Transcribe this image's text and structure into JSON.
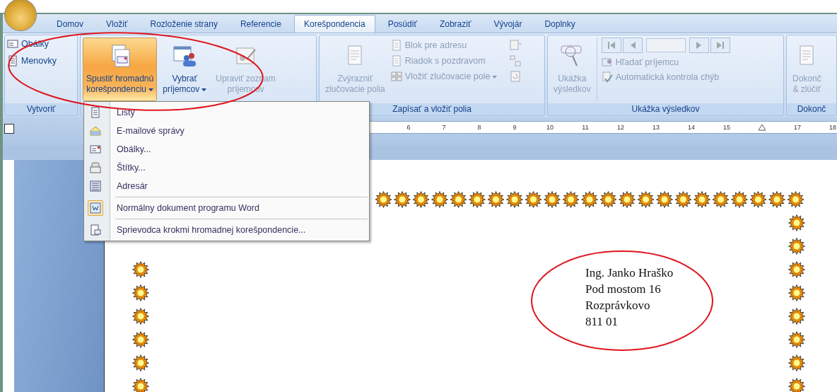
{
  "tabs": [
    {
      "label": "Domov",
      "selected": false
    },
    {
      "label": "Vložiť",
      "selected": false
    },
    {
      "label": "Rozloženie strany",
      "selected": false
    },
    {
      "label": "Referencie",
      "selected": false
    },
    {
      "label": "Korešpondencia",
      "selected": true
    },
    {
      "label": "Posúdiť",
      "selected": false
    },
    {
      "label": "Zobraziť",
      "selected": false
    },
    {
      "label": "Vývojár",
      "selected": false
    },
    {
      "label": "Doplnky",
      "selected": false
    }
  ],
  "ribbon": {
    "groups": [
      {
        "kind": "create",
        "label": "Vytvoriť",
        "small": [
          {
            "label": "Obálky",
            "disabled": false
          },
          {
            "label": "Menovky",
            "disabled": false
          }
        ]
      },
      {
        "kind": "start",
        "large": [
          {
            "lines": [
              "Spustiť hromadnú",
              "korešpondenciu"
            ],
            "dropdown": true,
            "pressed": true,
            "disabled": false
          },
          {
            "lines": [
              "Vybrať",
              "príjemcov"
            ],
            "dropdown": true,
            "pressed": false,
            "disabled": false
          },
          {
            "lines": [
              "Upraviť zoznam",
              "príjemcov"
            ],
            "dropdown": false,
            "pressed": false,
            "disabled": true
          }
        ]
      },
      {
        "kind": "write",
        "label": "Zapísať a vložiť polia",
        "large": [
          {
            "lines": [
              "Zvýrazniť",
              "zlučovacie polia"
            ],
            "dropdown": false,
            "pressed": false,
            "disabled": true
          }
        ],
        "small": [
          {
            "label": "Blok pre adresu",
            "disabled": true,
            "dropdown": false
          },
          {
            "label": "Riadok s pozdravom",
            "disabled": true,
            "dropdown": false
          },
          {
            "label": "Vložiť zlučovacie pole",
            "disabled": true,
            "dropdown": true
          }
        ]
      },
      {
        "kind": "preview",
        "label": "Ukážka výsledkov",
        "large": [
          {
            "lines": [
              "Ukážka",
              "výsledkov"
            ],
            "dropdown": false,
            "pressed": false,
            "disabled": true
          }
        ],
        "small": [
          {
            "label": "Hľadať príjemcu",
            "disabled": true
          },
          {
            "label": "Automatická kontrola chýb",
            "disabled": true
          }
        ]
      },
      {
        "kind": "finish",
        "label": "Dokonč",
        "large": [
          {
            "lines": [
              "Dokonč",
              "& zlúčiť"
            ],
            "dropdown": false,
            "pressed": false,
            "disabled": true
          }
        ]
      }
    ]
  },
  "menu": {
    "items": [
      {
        "label": "Listy",
        "checked": false,
        "separator_before": false
      },
      {
        "label": "E-mailové správy",
        "checked": false,
        "separator_before": false
      },
      {
        "label": "Obálky...",
        "checked": false,
        "separator_before": false
      },
      {
        "label": "Štítky...",
        "checked": false,
        "separator_before": false
      },
      {
        "label": "Adresár",
        "checked": false,
        "separator_before": false
      },
      {
        "label": "Normálny dokument programu Word",
        "checked": true,
        "separator_before": true
      },
      {
        "label": "Sprievodca krokmi hromadnej korešpondencie...",
        "checked": false,
        "separator_before": true
      }
    ]
  },
  "ruler": {
    "marks": [
      {
        "kind": "number",
        "text": "6"
      },
      {
        "kind": "number",
        "text": "7"
      },
      {
        "kind": "number",
        "text": "8"
      },
      {
        "kind": "number",
        "text": "9"
      },
      {
        "kind": "number",
        "text": "10"
      },
      {
        "kind": "number",
        "text": "11"
      },
      {
        "kind": "number",
        "text": "12"
      },
      {
        "kind": "number",
        "text": "13"
      },
      {
        "kind": "number",
        "text": "14"
      },
      {
        "kind": "number",
        "text": "15"
      },
      {
        "kind": "indent-marker"
      },
      {
        "kind": "number",
        "text": "17"
      },
      {
        "kind": "number",
        "text": "18"
      }
    ]
  },
  "document": {
    "address": [
      "Ing. Janko Hraško",
      "Pod mostom 16",
      "Rozprávkovo",
      "811 01"
    ]
  },
  "annotations": [
    {
      "kind": "ellipse"
    },
    {
      "kind": "ellipse"
    }
  ]
}
